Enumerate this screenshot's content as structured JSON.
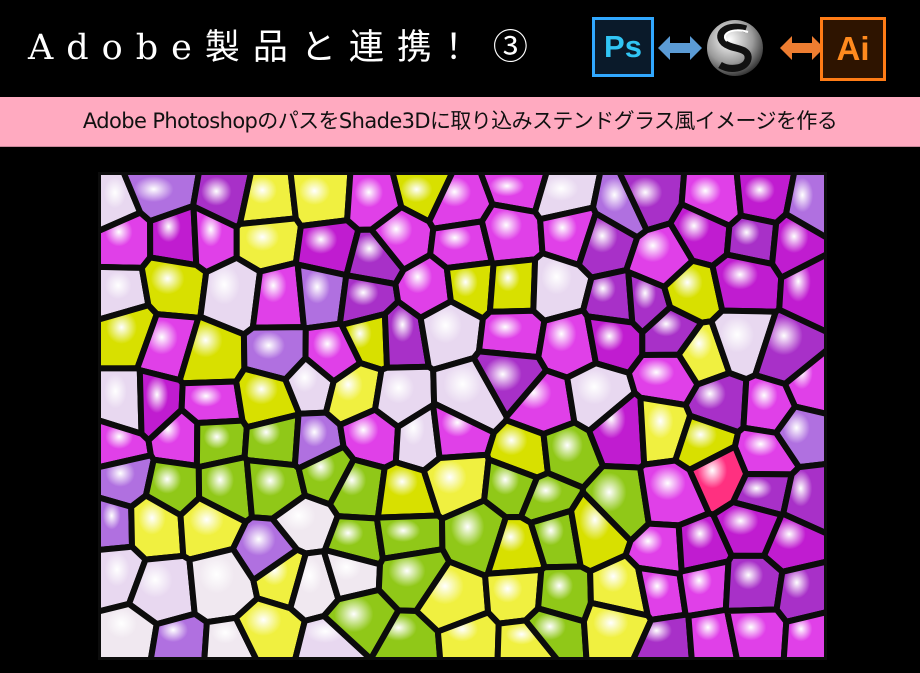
{
  "header": {
    "title": "Adobe製品と連携！③",
    "logos": [
      {
        "name": "photoshop-logo",
        "text": "Ps",
        "border_color": "#31a8ff",
        "text_color": "#31c5f4"
      },
      {
        "name": "shade3d-logo",
        "text": ""
      },
      {
        "name": "illustrator-logo",
        "text": "Ai",
        "border_color": "#ff7c16",
        "text_color": "#ff8a1e"
      }
    ],
    "arrows": [
      {
        "name": "bidirectional-arrow-blue",
        "color": "#5b9bd5"
      },
      {
        "name": "bidirectional-arrow-orange",
        "color": "#ed7d31"
      }
    ]
  },
  "subtitle": {
    "text": "Adobe PhotoshopのパスをShade3Dに取り込みステンドグラス風イメージを作る",
    "background": "#ffaac0"
  },
  "image": {
    "description": "Stained glass style image of purple, yellow and green flowers",
    "palette": [
      "#c01cd0",
      "#e040e8",
      "#b070e0",
      "#f0f040",
      "#d8e000",
      "#90c818",
      "#f0e8f0",
      "#ff3080",
      "#a830c8",
      "#e8d8f0"
    ]
  }
}
